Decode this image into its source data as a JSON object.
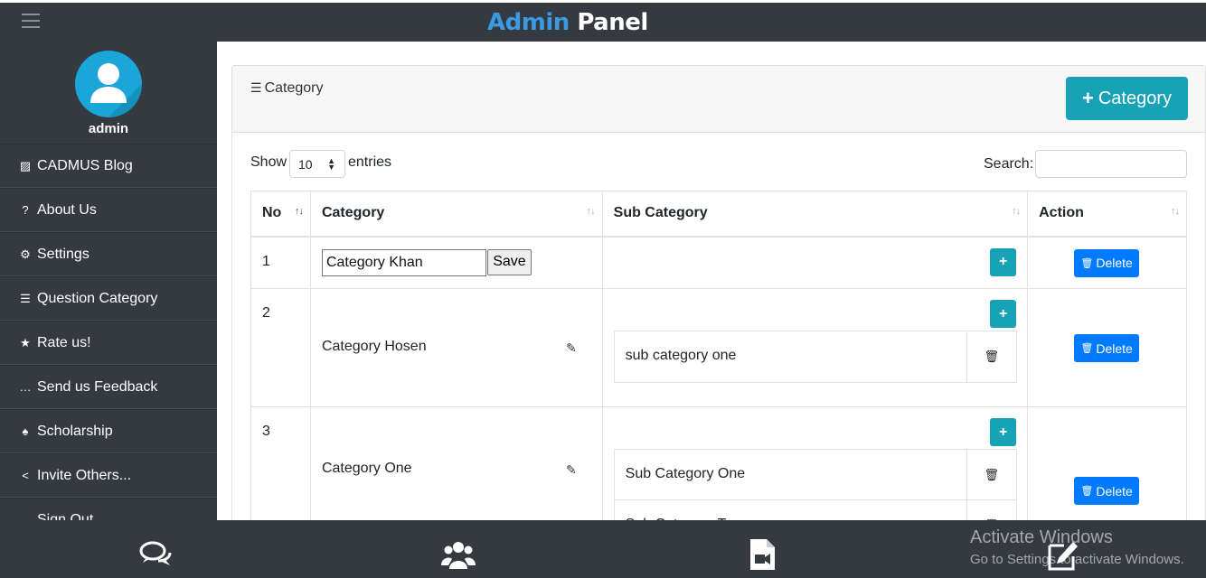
{
  "app": {
    "brand_part1": "Admin",
    "brand_part2": "Panel"
  },
  "sidebar": {
    "username": "admin",
    "items": [
      {
        "icon": "rss-icon",
        "glyph": "▨",
        "label": "CADMUS Blog"
      },
      {
        "icon": "question-circle-icon",
        "glyph": "?",
        "label": "About Us"
      },
      {
        "icon": "cogs-icon",
        "glyph": "⚙",
        "label": "Settings"
      },
      {
        "icon": "list-icon",
        "glyph": "☰",
        "label": "Question Category"
      },
      {
        "icon": "star-icon",
        "glyph": "★",
        "label": "Rate us!"
      },
      {
        "icon": "comment-icon",
        "glyph": "…",
        "label": "Send us Feedback"
      },
      {
        "icon": "trophy-icon",
        "glyph": "♠",
        "label": "Scholarship"
      },
      {
        "icon": "share-icon",
        "glyph": "<",
        "label": "Invite Others..."
      },
      {
        "icon": "sign-out-icon",
        "glyph": "→",
        "label": "Sign Out"
      }
    ]
  },
  "card": {
    "title": "Category",
    "add_button": "Category"
  },
  "datatable": {
    "show_label": "Show",
    "page_size": "10",
    "entries_label": "entries",
    "search_label": "Search:",
    "search_value": ""
  },
  "table": {
    "headers": [
      "No",
      "Category",
      "Sub Category",
      "Action"
    ],
    "delete_label": "Delete",
    "rows": [
      {
        "no": "1",
        "category": "Category Khan",
        "editing": true,
        "save_label": "Save",
        "subcategories": []
      },
      {
        "no": "2",
        "category": "Category Hosen",
        "editing": false,
        "subcategories": [
          "sub category one"
        ]
      },
      {
        "no": "3",
        "category": "Category One",
        "editing": false,
        "subcategories": [
          "Sub Category One",
          "Sub Category Two"
        ]
      }
    ]
  },
  "bottom_nav": [
    "comments-icon",
    "users-icon",
    "video-file-icon",
    "edit-icon"
  ],
  "watermark": {
    "line1": "Activate Windows",
    "line2": "Go to Settings to activate Windows."
  },
  "colors": {
    "topbar": "#343a40",
    "brand_accent": "#3b9ae1",
    "info": "#17a2b8",
    "primary": "#007bff"
  }
}
